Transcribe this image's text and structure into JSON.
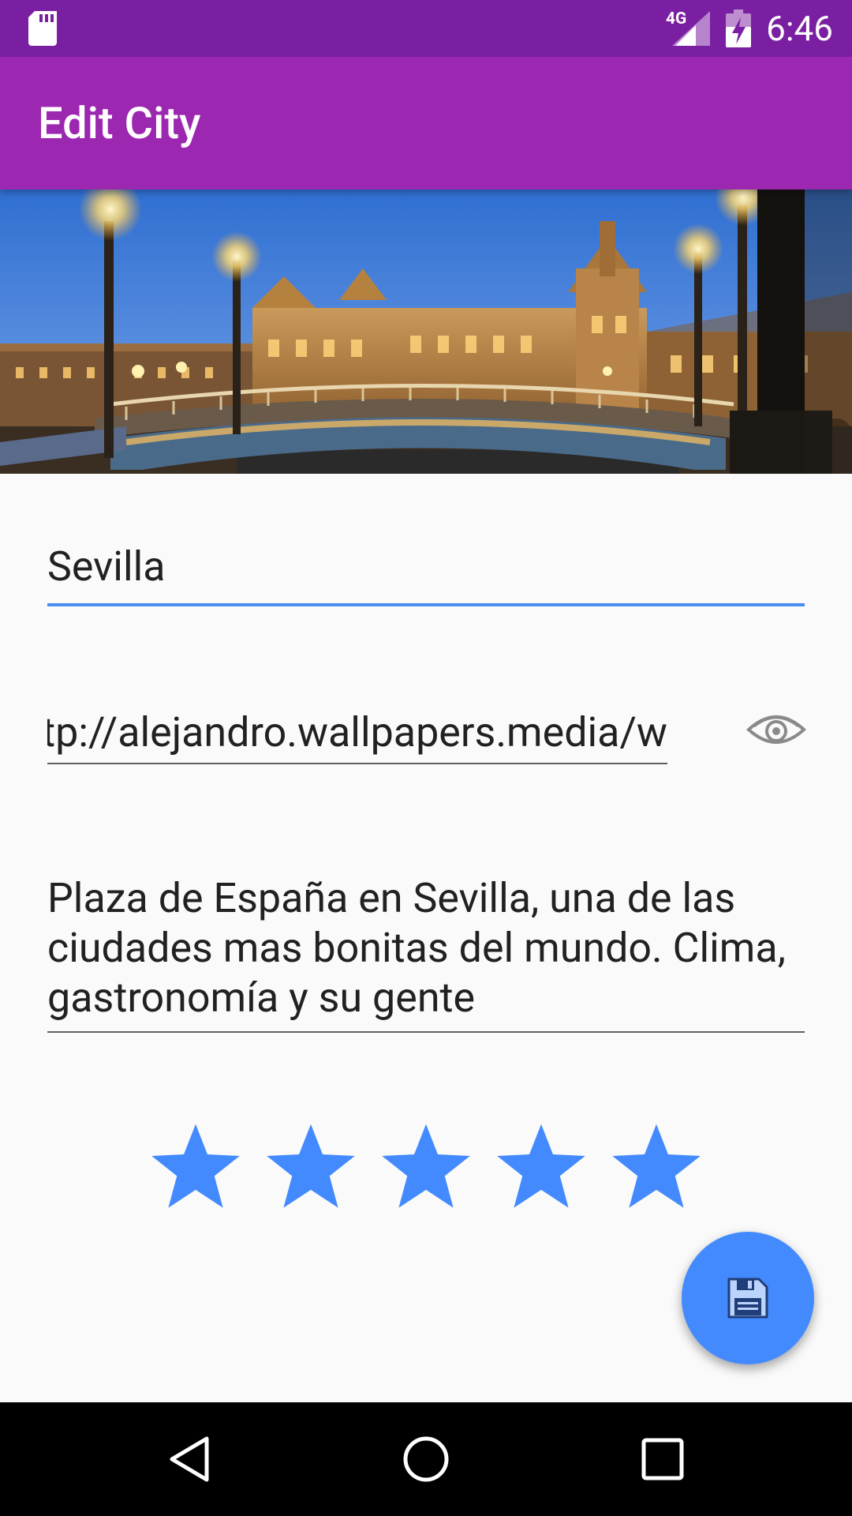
{
  "status_bar": {
    "network": "4G",
    "time": "6:46"
  },
  "app_bar": {
    "title": "Edit City"
  },
  "hero_image": {
    "subject": "Plaza de España, Sevilla at dusk"
  },
  "form": {
    "name_value": "Sevilla",
    "url_value": "http://alejandro.wallpapers.media/w",
    "description_value": "Plaza de España en Sevilla, una de las ciudades mas bonitas del mundo. Clima, gastronomía y su gente",
    "rating": 5,
    "rating_max": 5
  },
  "icons": {
    "preview": "eye-icon",
    "save": "floppy-disk-icon",
    "star": "star-icon"
  },
  "colors": {
    "status_bar": "#7b1fa2",
    "app_bar": "#9c27b0",
    "accent": "#448aff",
    "background": "#fafafa"
  }
}
